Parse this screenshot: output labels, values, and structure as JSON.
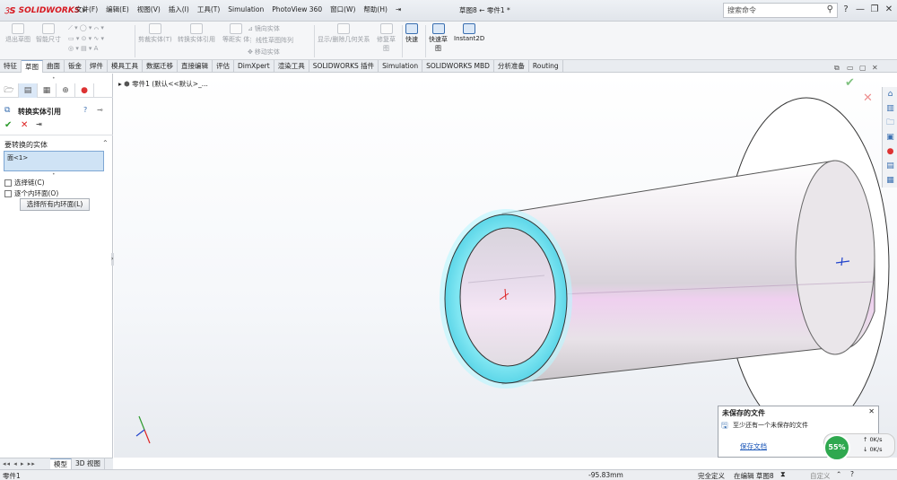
{
  "app": {
    "logo": "SOLIDWORKS",
    "document_title": "草图8 ← 零件1 *"
  },
  "menu": [
    "文件(F)",
    "编辑(E)",
    "视图(V)",
    "插入(I)",
    "工具(T)",
    "Simulation",
    "PhotoView 360",
    "窗口(W)",
    "帮助(H)"
  ],
  "search": {
    "placeholder": "搜索命令"
  },
  "commands": {
    "exit_sketch": "退出草图",
    "smart_dim": "智能尺寸",
    "trim": "剪裁实体(T)",
    "convert": "转换实体引用",
    "offset": "等距实\n体",
    "mirror": "镜向实体",
    "linear_pattern": "线性草图阵列",
    "move": "移动实体",
    "relations": "显示/删除几何关系",
    "repair": "修复草\n图",
    "quick_snap": "快速",
    "rapid_sketch": "快速草\n图",
    "instant2d": "Instant2D"
  },
  "tabs": [
    "特征",
    "草图",
    "曲面",
    "钣金",
    "焊件",
    "模具工具",
    "数据迁移",
    "直接编辑",
    "评估",
    "DimXpert",
    "渲染工具",
    "SOLIDWORKS 插件",
    "Simulation",
    "SOLIDWORKS MBD",
    "分析准备",
    "Routing"
  ],
  "active_tab": "草图",
  "property_manager": {
    "title": "转换实体引用",
    "section_title": "要转换的实体",
    "selected_entity": "面<1>",
    "select_chain": "选择链(C)",
    "each_inner_loop": "逐个内环面(O)",
    "select_all_inner": "选择所有内环面(L)"
  },
  "feature_tree": {
    "root": "零件1 (默认<<默认>_..."
  },
  "notification": {
    "title": "未保存的文件",
    "body": "至少还有一个未保存的文件",
    "link": "保存文档"
  },
  "network": {
    "percent": "55%",
    "up": "0K/s",
    "down": "0K/s"
  },
  "bottom_tabs": [
    "模型",
    "3D 视图"
  ],
  "status": {
    "part": "零件1",
    "coordinate": "-95.83mm",
    "defined": "完全定义",
    "editing": "在编辑 草图8",
    "custom": "自定义"
  },
  "colors": {
    "accent": "#3a6fb0",
    "brand_red": "#d71920",
    "selection": "#5de0f0",
    "cylinder_highlight": "#efd0ef"
  }
}
